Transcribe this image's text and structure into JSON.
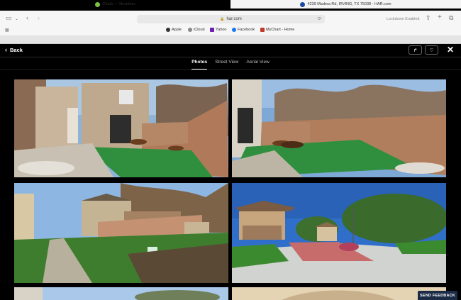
{
  "browser": {
    "url": "har.com",
    "lockdown": "Lockdown Enabled",
    "bookmarks": [
      "Apple",
      "iCloud",
      "Yahoo",
      "Facebook",
      "MyChart - Home"
    ],
    "tabs": [
      {
        "label": "Chalis — Nextdoor"
      },
      {
        "label": "4239 Madera Rd, IRVING, TX 75038 - HAR.com"
      }
    ]
  },
  "viewer": {
    "back_label": "Back",
    "tabs": [
      {
        "label": "Photos"
      },
      {
        "label": "Street View"
      },
      {
        "label": "Aerial View"
      }
    ]
  },
  "feedback": {
    "label": "SEND FEEDBACK"
  },
  "colors": {
    "accent": "#1b2a45",
    "header_bg": "#000000",
    "browser_bg": "#f6f6f6"
  }
}
